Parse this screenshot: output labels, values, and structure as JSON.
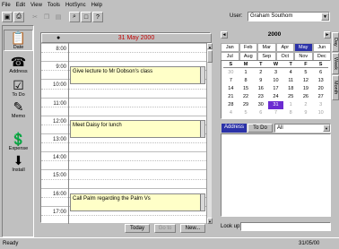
{
  "menu": [
    "File",
    "Edit",
    "View",
    "Tools",
    "HotSync",
    "Help"
  ],
  "toolbar": {
    "icons": [
      "save-icon",
      "print-icon",
      "cut-icon",
      "copy-icon",
      "paste-icon",
      "find-icon",
      "new-window-icon",
      "help-icon"
    ]
  },
  "user": {
    "label": "User:",
    "value": "Graham Southom"
  },
  "leftbar": [
    "Date",
    "Address",
    "To Do",
    "Memo",
    "Expense",
    "Install"
  ],
  "day": {
    "title": "31 May 2000",
    "times": [
      "8:00",
      "9:00",
      "10:00",
      "11:00",
      "12:00",
      "13:00",
      "14:00",
      "15:00",
      "16:00",
      "17:00"
    ],
    "appointments": [
      "Give lecture to Mr Dobson's class",
      "Meet Daisy for lunch",
      "Call Palm regarding the Palm Vs"
    ]
  },
  "buttons": {
    "today": "Today",
    "goto": "Go to",
    "new": "New..."
  },
  "calendar": {
    "year": "2000",
    "months": [
      "Jan",
      "Feb",
      "Mar",
      "Apr",
      "May",
      "Jun",
      "Jul",
      "Aug",
      "Sep",
      "Oct",
      "Nov",
      "Dec"
    ],
    "selected_month": "May",
    "weekdays": [
      "S",
      "M",
      "T",
      "W",
      "T",
      "F",
      "S"
    ],
    "dates": [
      "30",
      "1",
      "2",
      "3",
      "4",
      "5",
      "6",
      "7",
      "8",
      "9",
      "10",
      "11",
      "12",
      "13",
      "14",
      "15",
      "16",
      "17",
      "18",
      "19",
      "20",
      "21",
      "22",
      "23",
      "24",
      "25",
      "26",
      "27",
      "28",
      "29",
      "30",
      "31",
      "1",
      "2",
      "3",
      "4",
      "5",
      "6",
      "7",
      "8",
      "9",
      "10"
    ],
    "today": "31"
  },
  "side_tabs": [
    "Day",
    "Week",
    "Month"
  ],
  "address_panel": {
    "tab_address": "Address",
    "tab_todo": "To Do",
    "filter": "All"
  },
  "lookup": {
    "label": "Look up:"
  },
  "status": {
    "left": "Ready",
    "date": "31/05/00"
  }
}
